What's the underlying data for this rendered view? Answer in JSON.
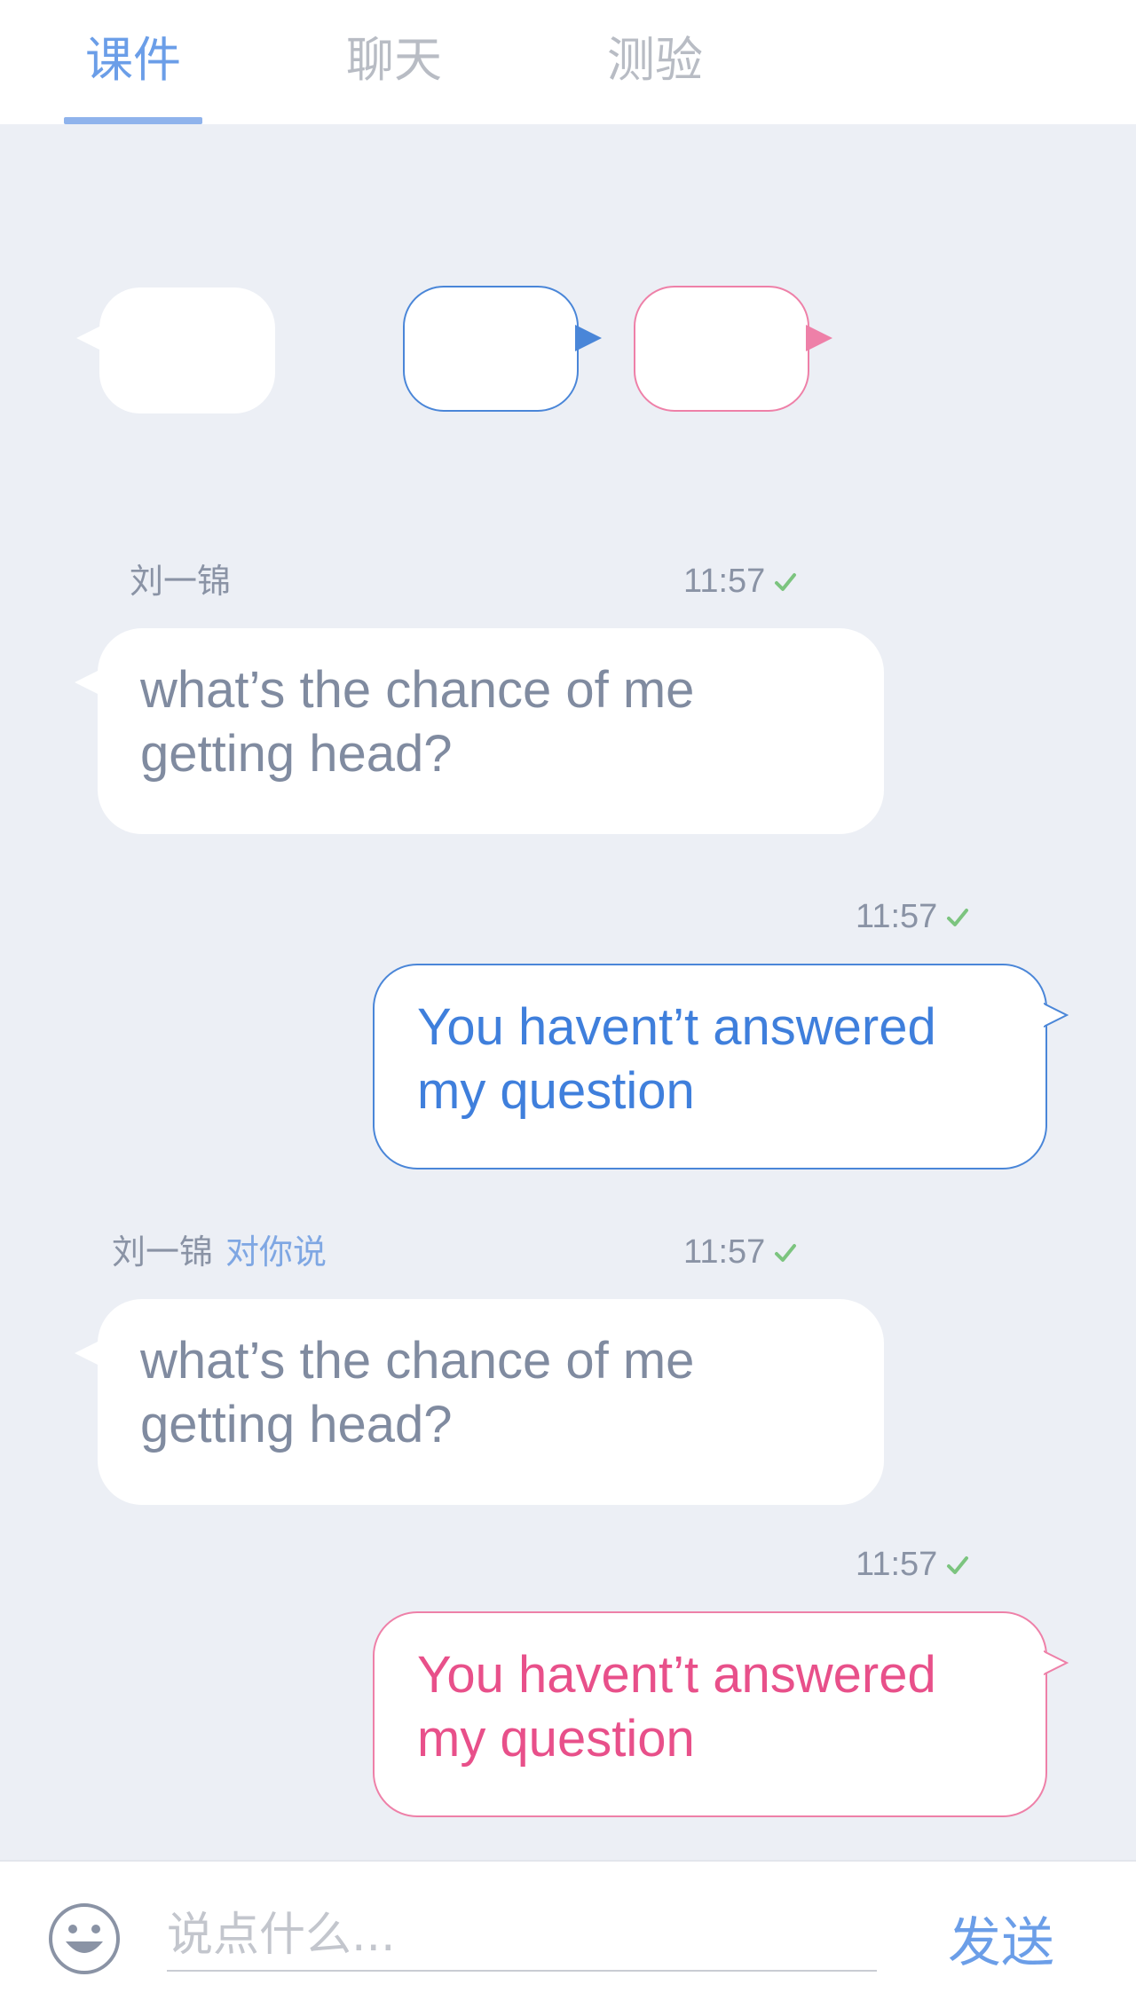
{
  "tabs": [
    {
      "label": "课件",
      "active": true
    },
    {
      "label": "聊天",
      "active": false
    },
    {
      "label": "测验",
      "active": false
    }
  ],
  "colors": {
    "accent": "#6b9ee8",
    "chat_bg": "#eceff5",
    "blue_bubble": "#4a86d8",
    "pink_bubble": "#e8508a",
    "check": "#7cc47f"
  },
  "messages": [
    {
      "sender": "刘一锦",
      "to_you": "",
      "time": "11:57",
      "text_line1": "what’s the chance of me",
      "text_line2": "getting head?"
    },
    {
      "sender": "",
      "to_you": "",
      "time": "11:57",
      "text_line1": "You havent’t answered",
      "text_line2": "my question"
    },
    {
      "sender": "刘一锦",
      "to_you": "对你说",
      "time": "11:57",
      "text_line1": "what’s the chance of me",
      "text_line2": "getting head?"
    },
    {
      "sender": "",
      "to_you": "",
      "time": "11:57",
      "text_line1": "You havent’t answered",
      "text_line2": "my question"
    }
  ],
  "input": {
    "placeholder": "说点什么...",
    "value": "",
    "send_label": "发送",
    "emoji_icon": "smiley-icon"
  }
}
